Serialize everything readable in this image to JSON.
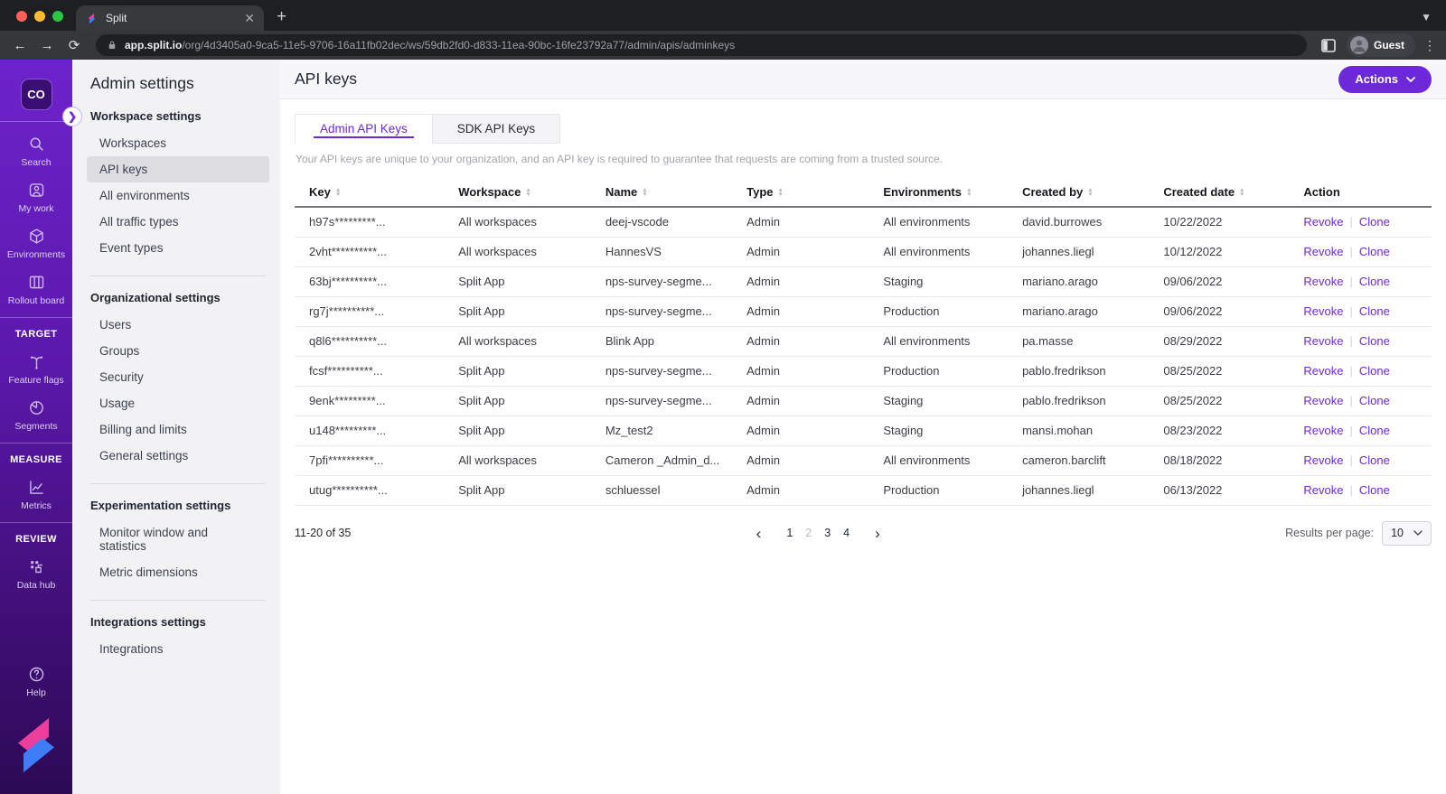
{
  "colors": {
    "accent": "#6d28d9",
    "rail_top": "#6d23cb",
    "rail_bottom": "#2c0a55",
    "selected_bg": "#dcdce1",
    "traffic_red": "#ff5f57",
    "traffic_yellow": "#febc2e",
    "traffic_green": "#2ac840",
    "logo_pink": "#ec3f9d",
    "logo_blue": "#3d7df6"
  },
  "browser": {
    "tab_title": "Split",
    "url_host": "app.split.io",
    "url_path": "/org/4d3405a0-9ca5-11e5-9706-16a11fb02dec/ws/59db2fd0-d833-11ea-90bc-16fe23792a77/admin/apis/adminkeys",
    "profile_label": "Guest"
  },
  "rail": {
    "workspace_badge": "CO",
    "primary_items": [
      {
        "icon": "search-icon",
        "label": "Search"
      },
      {
        "icon": "my-work-icon",
        "label": "My work"
      },
      {
        "icon": "environments-icon",
        "label": "Environments"
      },
      {
        "icon": "rollout-board-icon",
        "label": "Rollout board"
      }
    ],
    "sections": [
      {
        "header": "TARGET",
        "items": [
          {
            "icon": "feature-flags-icon",
            "label": "Feature flags"
          },
          {
            "icon": "segments-icon",
            "label": "Segments"
          }
        ]
      },
      {
        "header": "MEASURE",
        "items": [
          {
            "icon": "metrics-icon",
            "label": "Metrics"
          }
        ]
      },
      {
        "header": "REVIEW",
        "items": [
          {
            "icon": "data-hub-icon",
            "label": "Data hub"
          }
        ]
      }
    ],
    "help_label": "Help"
  },
  "nav": {
    "title": "Admin settings",
    "groups": [
      {
        "header": "Workspace settings",
        "selected": "API keys",
        "items": [
          "Workspaces",
          "API keys",
          "All environments",
          "All traffic types",
          "Event types"
        ]
      },
      {
        "header": "Organizational settings",
        "selected": "",
        "items": [
          "Users",
          "Groups",
          "Security",
          "Usage",
          "Billing and limits",
          "General settings"
        ]
      },
      {
        "header": "Experimentation settings",
        "selected": "",
        "items": [
          "Monitor window and statistics",
          "Metric dimensions"
        ]
      },
      {
        "header": "Integrations settings",
        "selected": "",
        "items": [
          "Integrations"
        ]
      }
    ]
  },
  "main": {
    "title": "API keys",
    "actions_label": "Actions",
    "tabs": [
      {
        "label": "Admin API Keys",
        "active": true
      },
      {
        "label": "SDK API Keys",
        "active": false
      }
    ],
    "description": "Your API keys are unique to your organization, and an API key is required to guarantee that requests are coming from a trusted source.",
    "table": {
      "columns": [
        {
          "label": "Key",
          "sortable": true
        },
        {
          "label": "Workspace",
          "sortable": true
        },
        {
          "label": "Name",
          "sortable": true
        },
        {
          "label": "Type",
          "sortable": true
        },
        {
          "label": "Environments",
          "sortable": true
        },
        {
          "label": "Created by",
          "sortable": true
        },
        {
          "label": "Created date",
          "sortable": true
        },
        {
          "label": "Action",
          "sortable": false
        }
      ],
      "action_links": [
        "Revoke",
        "Clone"
      ],
      "rows": [
        [
          "h97s*********...",
          "All workspaces",
          "deej-vscode",
          "Admin",
          "All environments",
          "david.burrowes",
          "10/22/2022"
        ],
        [
          "2vht**********...",
          "All workspaces",
          "HannesVS",
          "Admin",
          "All environments",
          "johannes.liegl",
          "10/12/2022"
        ],
        [
          "63bj**********...",
          "Split App",
          "nps-survey-segme...",
          "Admin",
          "Staging",
          "mariano.arago",
          "09/06/2022"
        ],
        [
          "rg7j**********...",
          "Split App",
          "nps-survey-segme...",
          "Admin",
          "Production",
          "mariano.arago",
          "09/06/2022"
        ],
        [
          "q8l6**********...",
          "All workspaces",
          "Blink App",
          "Admin",
          "All environments",
          "pa.masse",
          "08/29/2022"
        ],
        [
          "fcsf**********...",
          "Split App",
          "nps-survey-segme...",
          "Admin",
          "Production",
          "pablo.fredrikson",
          "08/25/2022"
        ],
        [
          "9enk*********...",
          "Split App",
          "nps-survey-segme...",
          "Admin",
          "Staging",
          "pablo.fredrikson",
          "08/25/2022"
        ],
        [
          "u148*********...",
          "Split App",
          "Mz_test2",
          "Admin",
          "Staging",
          "mansi.mohan",
          "08/23/2022"
        ],
        [
          "7pfi**********...",
          "All workspaces",
          "Cameron _Admin_d...",
          "Admin",
          "All environments",
          "cameron.barclift",
          "08/18/2022"
        ],
        [
          "utug**********...",
          "Split App",
          "schluessel",
          "Admin",
          "Production",
          "johannes.liegl",
          "06/13/2022"
        ]
      ]
    },
    "pagination": {
      "range_text": "11-20 of 35",
      "pages": [
        "1",
        "2",
        "3",
        "4"
      ],
      "current_page": "2",
      "results_label": "Results per page:",
      "results_value": "10"
    }
  }
}
